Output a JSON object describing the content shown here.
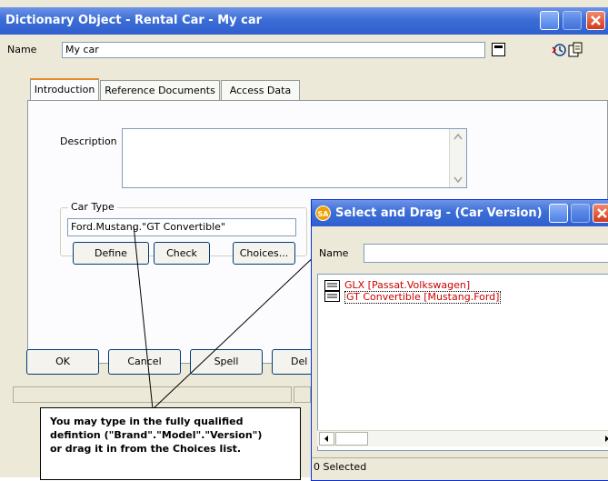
{
  "main_window": {
    "title": "Dictionary Object - Rental Car - My car",
    "name_label": "Name",
    "name_value": "My car",
    "tabs": [
      {
        "label": "Introduction",
        "active": true
      },
      {
        "label": "Reference Documents",
        "active": false
      },
      {
        "label": "Access Data",
        "active": false
      }
    ],
    "description_label": "Description",
    "description_value": "",
    "car_type": {
      "group_label": "Car Type",
      "value": "Ford.Mustang.\"GT Convertible\"",
      "define_label": "Define",
      "check_label": "Check",
      "choices_label": "Choices..."
    },
    "buttons": {
      "ok": "OK",
      "cancel": "Cancel",
      "spell": "Spell",
      "delete_partial": "Del"
    }
  },
  "select_window": {
    "badge": "SA",
    "title": "Select and Drag - (Car Version)",
    "name_label": "Name",
    "name_value": "",
    "items": [
      {
        "label": "GLX [Passat.Volkswagen]"
      },
      {
        "label": "GT Convertible [Mustang.Ford]"
      }
    ],
    "status": "0 Selected"
  },
  "note": {
    "line1": "You may type in the fully qualified",
    "line2": "defintion (\"Brand\".\"Model\".\"Version\")",
    "line3": "or drag it in from the Choices list."
  },
  "colors": {
    "titlebar": "#2f5fcf",
    "list_item_text": "#cc0000",
    "dialog_bg": "#ece9d8"
  }
}
